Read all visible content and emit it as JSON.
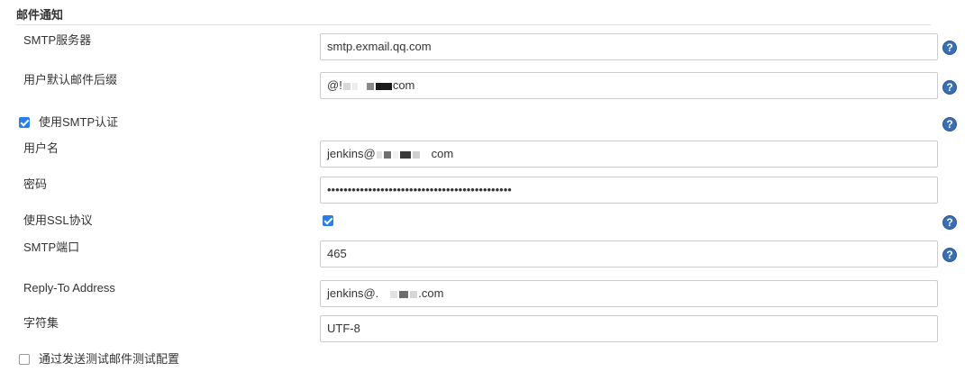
{
  "section": {
    "title": "邮件通知"
  },
  "fields": {
    "smtp_server": {
      "label": "SMTP服务器",
      "value": "smtp.exmail.qq.com"
    },
    "default_suffix": {
      "label": "用户默认邮件后缀",
      "value_prefix": "@!",
      "value_suffix": "com"
    },
    "use_smtp_auth": {
      "label": "使用SMTP认证",
      "checked": true
    },
    "username": {
      "label": "用户名",
      "value_prefix": "jenkins@",
      "value_suffix": "com"
    },
    "password": {
      "label": "密码",
      "value": "•••••••••••••••••••••••••••••••••••••••••••••"
    },
    "use_ssl": {
      "label": "使用SSL协议",
      "checked": true
    },
    "smtp_port": {
      "label": "SMTP端口",
      "value": "465"
    },
    "reply_to": {
      "label": "Reply-To Address",
      "value_prefix": "jenkins@.",
      "value_suffix": ".com"
    },
    "charset": {
      "label": "字符集",
      "value": "UTF-8"
    },
    "test_config": {
      "label": "通过发送测试邮件测试配置",
      "checked": false
    }
  },
  "help_icon_glyph": "?",
  "colors": {
    "help_icon": "#3a6fb3",
    "checkbox_checked": "#2a7ee8"
  }
}
